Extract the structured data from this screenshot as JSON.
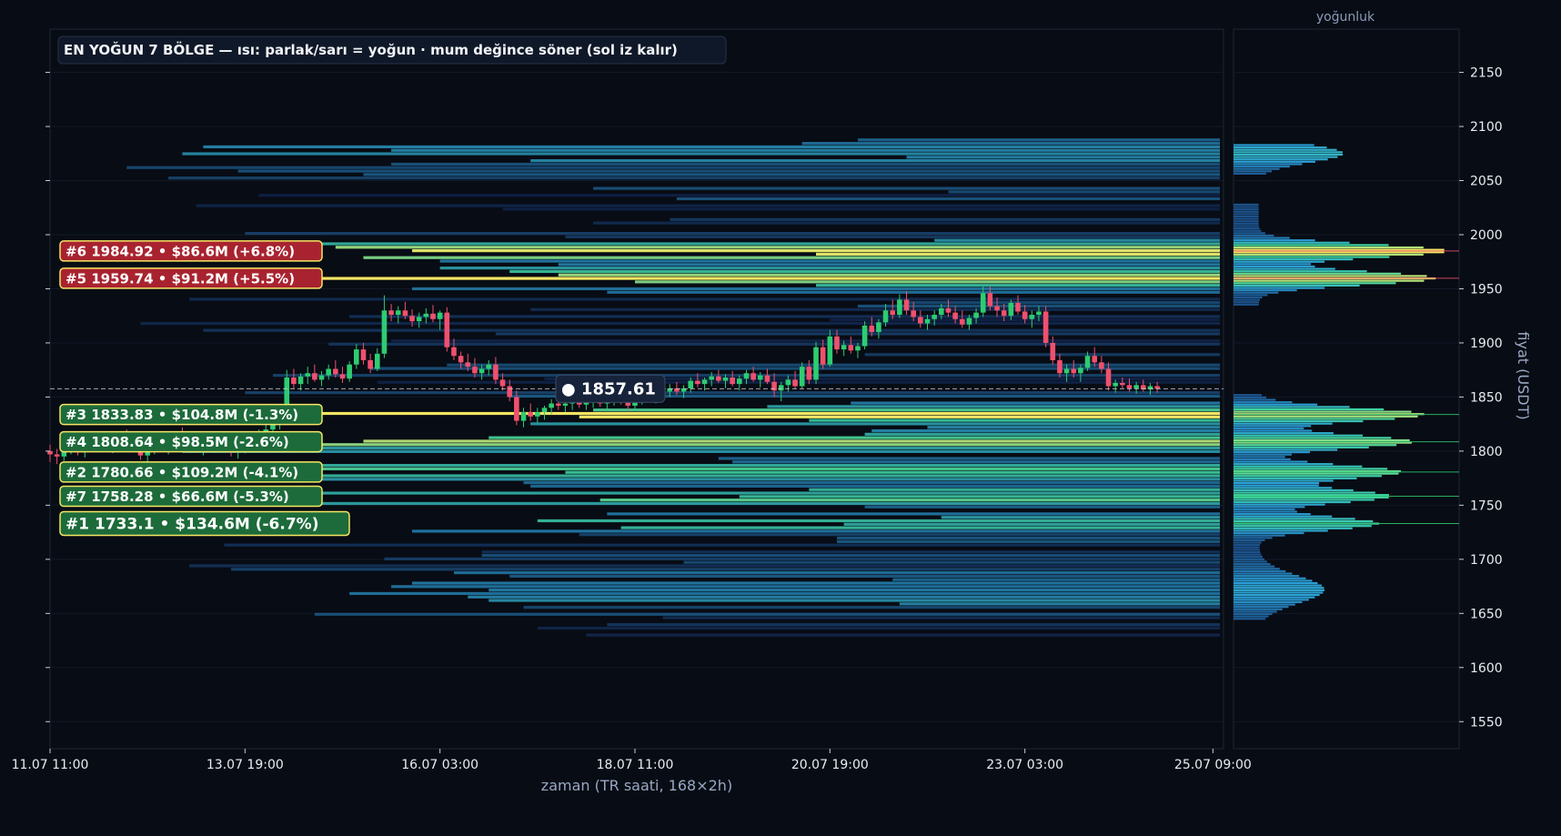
{
  "chart_data": {
    "type": "heatmap",
    "title": "EN YOĞUN 7 BÖLGE — ısı: parlak/sarı = yoğun · mum değince söner (sol iz kalır)",
    "xlabel": "zaman (TR saati, 168×2h)",
    "ylabel": "fiyat (USDT)",
    "profile_title": "yoğunluk",
    "ylim": [
      1525,
      2190
    ],
    "yticks": [
      1550,
      1600,
      1650,
      1700,
      1750,
      1800,
      1850,
      1900,
      1950,
      2000,
      2050,
      2100,
      2150
    ],
    "xlim": [
      0,
      168
    ],
    "xticks": [
      {
        "x": 0,
        "label": "11.07 11:00"
      },
      {
        "x": 28,
        "label": "13.07 19:00"
      },
      {
        "x": 56,
        "label": "16.07 03:00"
      },
      {
        "x": 84,
        "label": "18.07 11:00"
      },
      {
        "x": 112,
        "label": "20.07 19:00"
      },
      {
        "x": 140,
        "label": "23.07 03:00"
      },
      {
        "x": 167,
        "label": "25.07 09:00"
      }
    ],
    "current_price": 1857.61,
    "current_price_label": "● 1857.61",
    "zones": [
      {
        "rank": 6,
        "price": 1984.92,
        "label": "#6  1984.92  •  $86.6M  (+6.8%)",
        "side": "above"
      },
      {
        "rank": 5,
        "price": 1959.74,
        "label": "#5  1959.74  •  $91.2M  (+5.5%)",
        "side": "above"
      },
      {
        "rank": 3,
        "price": 1833.83,
        "label": "#3  1833.83  •  $104.8M  (-1.3%)",
        "side": "below"
      },
      {
        "rank": 4,
        "price": 1808.64,
        "label": "#4  1808.64  •  $98.5M  (-2.6%)",
        "side": "below"
      },
      {
        "rank": 2,
        "price": 1780.66,
        "label": "#2  1780.66  •  $109.2M  (-4.1%)",
        "side": "below"
      },
      {
        "rank": 7,
        "price": 1758.28,
        "label": "#7  1758.28  •  $66.6M  (-5.3%)",
        "side": "below"
      },
      {
        "rank": 1,
        "price": 1733.1,
        "label": "#1  1733.1  •  $134.6M  (-6.7%)",
        "side": "below"
      }
    ],
    "colors": {
      "background": "#080c14",
      "bull": "#2ecc71",
      "bear": "#f0506e",
      "heat_low": "#15306a",
      "heat_mid": "#2b9fd6",
      "heat_high": "#3fd6a0",
      "heat_peak": "#f5e663",
      "zone_above": "#a8232f",
      "zone_below": "#1d6b3a",
      "zone_border": "#f5e663"
    },
    "candles": [
      [
        1800,
        1806,
        1790,
        1797
      ],
      [
        1797,
        1802,
        1788,
        1795
      ],
      [
        1795,
        1803,
        1791,
        1800
      ],
      [
        1800,
        1809,
        1797,
        1806
      ],
      [
        1806,
        1810,
        1796,
        1799
      ],
      [
        1799,
        1808,
        1794,
        1805
      ],
      [
        1805,
        1815,
        1801,
        1812
      ],
      [
        1812,
        1818,
        1806,
        1808
      ],
      [
        1808,
        1814,
        1800,
        1803
      ],
      [
        1803,
        1810,
        1798,
        1807
      ],
      [
        1807,
        1816,
        1803,
        1813
      ],
      [
        1813,
        1820,
        1806,
        1809
      ],
      [
        1809,
        1815,
        1799,
        1802
      ],
      [
        1802,
        1807,
        1792,
        1796
      ],
      [
        1796,
        1803,
        1790,
        1800
      ],
      [
        1800,
        1811,
        1797,
        1808
      ],
      [
        1808,
        1814,
        1801,
        1804
      ],
      [
        1804,
        1810,
        1797,
        1806
      ],
      [
        1806,
        1818,
        1803,
        1815
      ],
      [
        1815,
        1822,
        1808,
        1811
      ],
      [
        1811,
        1817,
        1803,
        1807
      ],
      [
        1807,
        1812,
        1799,
        1802
      ],
      [
        1802,
        1809,
        1796,
        1805
      ],
      [
        1805,
        1813,
        1800,
        1810
      ],
      [
        1810,
        1816,
        1804,
        1806
      ],
      [
        1806,
        1812,
        1800,
        1803
      ],
      [
        1803,
        1808,
        1795,
        1799
      ],
      [
        1799,
        1806,
        1793,
        1803
      ],
      [
        1803,
        1810,
        1798,
        1806
      ],
      [
        1806,
        1815,
        1802,
        1812
      ],
      [
        1812,
        1820,
        1808,
        1816
      ],
      [
        1816,
        1825,
        1812,
        1820
      ],
      [
        1820,
        1830,
        1815,
        1826
      ],
      [
        1826,
        1835,
        1820,
        1830
      ],
      [
        1830,
        1875,
        1826,
        1868
      ],
      [
        1868,
        1876,
        1858,
        1862
      ],
      [
        1862,
        1872,
        1856,
        1869
      ],
      [
        1869,
        1878,
        1862,
        1872
      ],
      [
        1872,
        1880,
        1864,
        1866
      ],
      [
        1866,
        1874,
        1860,
        1870
      ],
      [
        1870,
        1880,
        1866,
        1876
      ],
      [
        1876,
        1884,
        1868,
        1871
      ],
      [
        1871,
        1878,
        1863,
        1867
      ],
      [
        1867,
        1883,
        1864,
        1880
      ],
      [
        1880,
        1899,
        1876,
        1894
      ],
      [
        1894,
        1900,
        1880,
        1884
      ],
      [
        1884,
        1890,
        1872,
        1876
      ],
      [
        1876,
        1895,
        1874,
        1890
      ],
      [
        1890,
        1944,
        1886,
        1930
      ],
      [
        1930,
        1936,
        1920,
        1926
      ],
      [
        1926,
        1934,
        1918,
        1930
      ],
      [
        1930,
        1938,
        1922,
        1925
      ],
      [
        1925,
        1931,
        1915,
        1920
      ],
      [
        1920,
        1928,
        1914,
        1924
      ],
      [
        1924,
        1932,
        1918,
        1927
      ],
      [
        1927,
        1935,
        1919,
        1922
      ],
      [
        1922,
        1930,
        1912,
        1928
      ],
      [
        1928,
        1933,
        1892,
        1896
      ],
      [
        1896,
        1904,
        1884,
        1888
      ],
      [
        1888,
        1892,
        1876,
        1882
      ],
      [
        1882,
        1890,
        1874,
        1878
      ],
      [
        1878,
        1886,
        1868,
        1872
      ],
      [
        1872,
        1880,
        1866,
        1876
      ],
      [
        1876,
        1884,
        1870,
        1880
      ],
      [
        1880,
        1887,
        1862,
        1866
      ],
      [
        1866,
        1872,
        1856,
        1860
      ],
      [
        1860,
        1866,
        1846,
        1850
      ],
      [
        1850,
        1856,
        1824,
        1828
      ],
      [
        1828,
        1840,
        1822,
        1836
      ],
      [
        1836,
        1844,
        1828,
        1832
      ],
      [
        1832,
        1840,
        1826,
        1836
      ],
      [
        1836,
        1842,
        1829,
        1840
      ],
      [
        1840,
        1848,
        1834,
        1844
      ],
      [
        1844,
        1852,
        1838,
        1842
      ],
      [
        1842,
        1847,
        1836,
        1844
      ],
      [
        1844,
        1850,
        1838,
        1846
      ],
      [
        1846,
        1852,
        1840,
        1843
      ],
      [
        1843,
        1848,
        1838,
        1845
      ],
      [
        1845,
        1850,
        1840,
        1847
      ],
      [
        1847,
        1852,
        1841,
        1844
      ],
      [
        1844,
        1849,
        1838,
        1846
      ],
      [
        1846,
        1853,
        1842,
        1850
      ],
      [
        1850,
        1856,
        1843,
        1846
      ],
      [
        1846,
        1850,
        1838,
        1842
      ],
      [
        1842,
        1849,
        1837,
        1847
      ],
      [
        1847,
        1855,
        1843,
        1852
      ],
      [
        1852,
        1858,
        1846,
        1849
      ],
      [
        1849,
        1854,
        1844,
        1851
      ],
      [
        1851,
        1858,
        1847,
        1855
      ],
      [
        1855,
        1862,
        1850,
        1858
      ],
      [
        1858,
        1864,
        1852,
        1855
      ],
      [
        1855,
        1861,
        1849,
        1858
      ],
      [
        1858,
        1868,
        1854,
        1865
      ],
      [
        1865,
        1872,
        1859,
        1862
      ],
      [
        1862,
        1868,
        1856,
        1866
      ],
      [
        1866,
        1873,
        1860,
        1869
      ],
      [
        1869,
        1875,
        1863,
        1865
      ],
      [
        1865,
        1871,
        1858,
        1868
      ],
      [
        1868,
        1874,
        1860,
        1862
      ],
      [
        1862,
        1870,
        1856,
        1867
      ],
      [
        1867,
        1875,
        1862,
        1872
      ],
      [
        1872,
        1878,
        1864,
        1866
      ],
      [
        1866,
        1873,
        1859,
        1870
      ],
      [
        1870,
        1876,
        1862,
        1864
      ],
      [
        1864,
        1872,
        1850,
        1856
      ],
      [
        1856,
        1864,
        1846,
        1861
      ],
      [
        1861,
        1870,
        1855,
        1866
      ],
      [
        1866,
        1874,
        1858,
        1860
      ],
      [
        1860,
        1882,
        1858,
        1878
      ],
      [
        1878,
        1884,
        1862,
        1866
      ],
      [
        1866,
        1901,
        1862,
        1896
      ],
      [
        1896,
        1903,
        1876,
        1880
      ],
      [
        1880,
        1912,
        1878,
        1906
      ],
      [
        1906,
        1912,
        1890,
        1894
      ],
      [
        1894,
        1902,
        1888,
        1898
      ],
      [
        1898,
        1906,
        1890,
        1893
      ],
      [
        1893,
        1900,
        1886,
        1897
      ],
      [
        1897,
        1920,
        1894,
        1916
      ],
      [
        1916,
        1924,
        1906,
        1910
      ],
      [
        1910,
        1922,
        1904,
        1919
      ],
      [
        1919,
        1936,
        1915,
        1930
      ],
      [
        1930,
        1940,
        1922,
        1926
      ],
      [
        1926,
        1945,
        1923,
        1940
      ],
      [
        1940,
        1948,
        1926,
        1930
      ],
      [
        1930,
        1938,
        1920,
        1924
      ],
      [
        1924,
        1930,
        1914,
        1918
      ],
      [
        1918,
        1926,
        1912,
        1922
      ],
      [
        1922,
        1930,
        1916,
        1926
      ],
      [
        1926,
        1936,
        1922,
        1932
      ],
      [
        1932,
        1940,
        1924,
        1928
      ],
      [
        1928,
        1934,
        1918,
        1922
      ],
      [
        1922,
        1930,
        1914,
        1917
      ],
      [
        1917,
        1926,
        1912,
        1923
      ],
      [
        1923,
        1932,
        1918,
        1928
      ],
      [
        1928,
        1952,
        1924,
        1946
      ],
      [
        1946,
        1952,
        1930,
        1934
      ],
      [
        1934,
        1942,
        1924,
        1930
      ],
      [
        1930,
        1936,
        1920,
        1925
      ],
      [
        1925,
        1940,
        1921,
        1937
      ],
      [
        1937,
        1944,
        1926,
        1929
      ],
      [
        1929,
        1935,
        1918,
        1922
      ],
      [
        1922,
        1930,
        1914,
        1926
      ],
      [
        1926,
        1934,
        1920,
        1929
      ],
      [
        1929,
        1934,
        1896,
        1900
      ],
      [
        1900,
        1906,
        1880,
        1884
      ],
      [
        1884,
        1890,
        1868,
        1872
      ],
      [
        1872,
        1880,
        1864,
        1876
      ],
      [
        1876,
        1884,
        1868,
        1872
      ],
      [
        1872,
        1880,
        1864,
        1877
      ],
      [
        1877,
        1892,
        1874,
        1888
      ],
      [
        1888,
        1896,
        1878,
        1882
      ],
      [
        1882,
        1888,
        1872,
        1876
      ],
      [
        1876,
        1882,
        1856,
        1860
      ],
      [
        1860,
        1866,
        1854,
        1863
      ],
      [
        1863,
        1868,
        1858,
        1861
      ],
      [
        1861,
        1867,
        1855,
        1858
      ],
      [
        1858,
        1864,
        1853,
        1861
      ],
      [
        1861,
        1866,
        1855,
        1857
      ],
      [
        1857,
        1863,
        1852,
        1860
      ],
      [
        1860,
        1864,
        1854,
        1857.61
      ]
    ]
  }
}
